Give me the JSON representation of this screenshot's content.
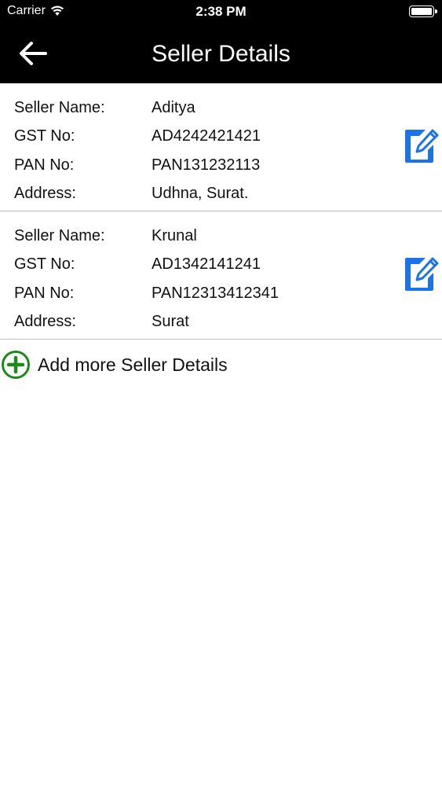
{
  "status_bar": {
    "carrier": "Carrier",
    "time": "2:38 PM"
  },
  "nav": {
    "title": "Seller Details",
    "back_icon": "arrow-left-icon"
  },
  "labels": {
    "seller_name": "Seller Name:",
    "gst_no": "GST No:",
    "pan_no": "PAN No:",
    "address": "Address:"
  },
  "sellers": [
    {
      "name": "Aditya",
      "gst": "AD4242421421",
      "pan": "PAN131232113",
      "address": "Udhna, Surat."
    },
    {
      "name": "Krunal",
      "gst": "AD1342141241",
      "pan": "PAN12313412341",
      "address": "Surat"
    }
  ],
  "add_more": {
    "label": "Add more Seller Details",
    "icon": "plus-circle-icon"
  },
  "colors": {
    "header_bg": "#000000",
    "edit_icon": "#1a73e8",
    "add_icon": "#1e8a1e",
    "divider": "#bdbdbd"
  }
}
